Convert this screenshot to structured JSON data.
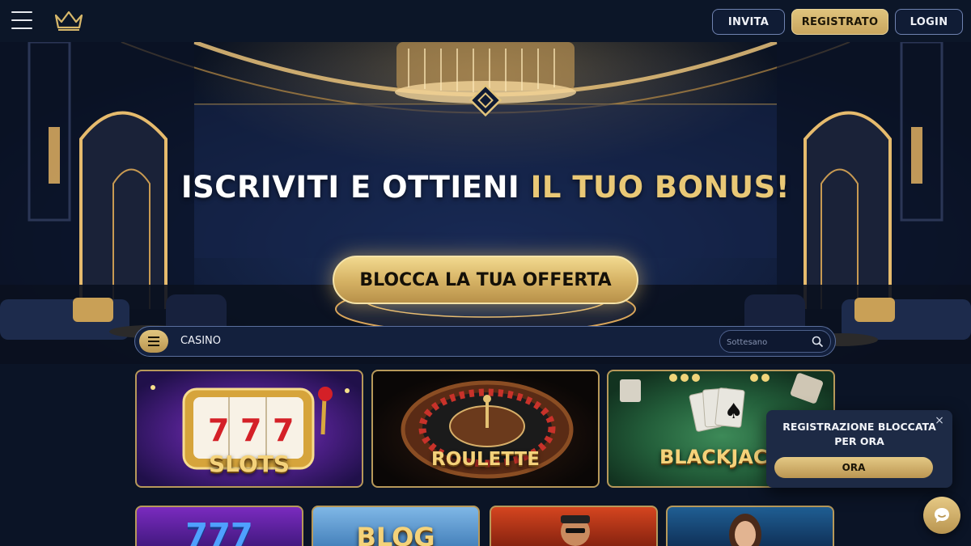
{
  "header": {
    "invita_label": "INVITA",
    "registrato_label": "REGISTRATO",
    "login_label": "LOGIN"
  },
  "hero": {
    "title_white": "ISCRIVITI E OTTIENI ",
    "title_gold": "IL TUO BONUS!",
    "cta_label": "BLOCCA LA TUA OFFERTA"
  },
  "category_bar": {
    "label": "CASINO",
    "search_placeholder": "Sottesano"
  },
  "games": [
    {
      "label": "SLOTS"
    },
    {
      "label": "ROULETTE"
    },
    {
      "label": "BLACKJACK"
    },
    {
      "label": "777"
    },
    {
      "label": "BLOG"
    },
    {
      "label": ""
    },
    {
      "label": ""
    }
  ],
  "popup": {
    "text": "REGISTRAZIONE BLOCCATA PER ORA",
    "button_label": "ORA",
    "close_symbol": "×"
  },
  "colors": {
    "gold": "#d9b86c",
    "navy": "#0c1628",
    "accent_border": "#6f82b0"
  },
  "icons": [
    "hamburger-menu-icon",
    "crown-logo-icon",
    "search-icon",
    "close-icon",
    "chat-bubble-icon"
  ]
}
